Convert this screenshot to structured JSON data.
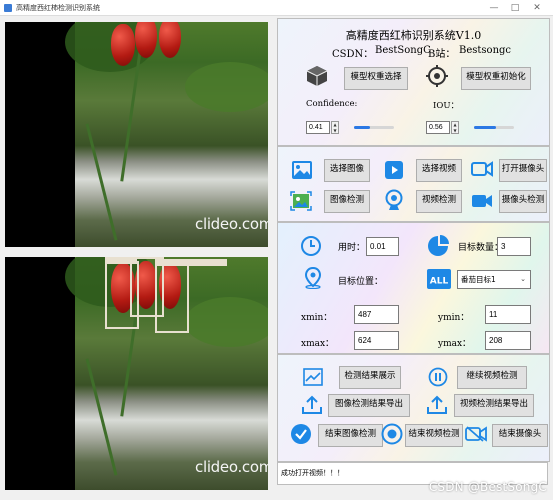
{
  "window": {
    "title": "高精度西红柿检测识别系统"
  },
  "video_top": {
    "watermark": "clideo.com"
  },
  "video_bottom": {
    "watermark": "clideo.com"
  },
  "header": {
    "title": "高精度西红柿识别系统V1.0",
    "csdn_label": "CSDN：",
    "csdn_value": "BestSongC",
    "bili_label": "B站：",
    "bili_value": "Bestsongc",
    "select_weight_label": "模型权重选择",
    "init_model_label": "模型权重初始化",
    "confidence_label": "Confidence:",
    "iou_label": "IOU：",
    "confidence_value": "0.41",
    "iou_value": "0.56",
    "confidence_level": 0.41,
    "iou_level": 0.56
  },
  "media": {
    "select_image": "选择图像",
    "select_video": "选择视频",
    "open_camera": "打开摄像头",
    "image_detect": "图像检测",
    "video_detect": "视频检测",
    "camera_detect": "摄像头检测"
  },
  "results": {
    "time_label": "用时：",
    "time_value": "0.01",
    "count_label": "目标数量：",
    "count_value": "3",
    "position_label": "目标位置：",
    "target_select": "番茄目标1",
    "xmin_label": "xmin：",
    "xmin_value": "487",
    "ymin_label": "ymin：",
    "ymin_value": "11",
    "xmax_label": "xmax：",
    "xmax_value": "624",
    "ymax_label": "ymax：",
    "ymax_value": "208"
  },
  "actions": {
    "show_results": "检测结果展示",
    "continue_video": "继续视频检测",
    "export_image": "图像检测结果导出",
    "export_video": "视频检测结果导出",
    "end_image": "结束图像检测",
    "end_video": "结束视频检测",
    "end_camera": "结束摄像头"
  },
  "status": {
    "message": "成功打开视频！！！"
  },
  "watermark": "CSDN @BestSongC",
  "colors": {
    "accent": "#2b78e4",
    "icon_blue": "#1e88e5"
  }
}
